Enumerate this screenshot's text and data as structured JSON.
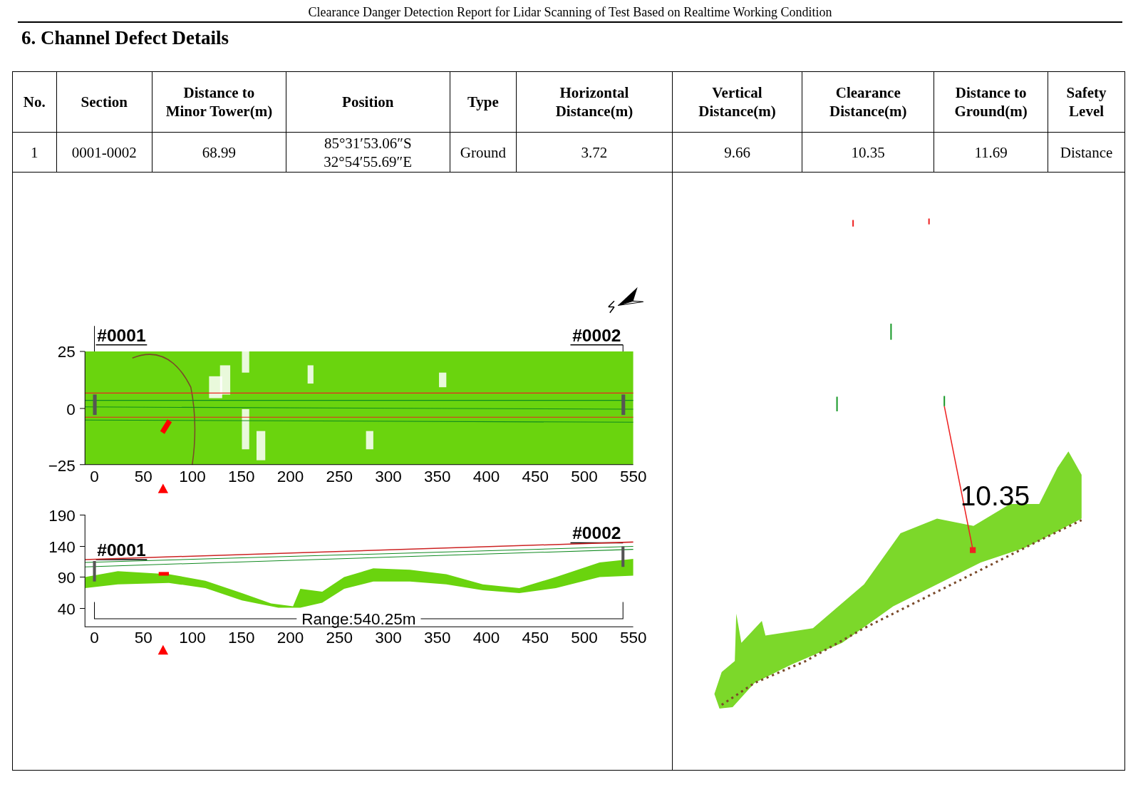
{
  "page_header": "Clearance Danger Detection Report for Lidar Scanning of Test Based on Realtime Working Condition",
  "section_title": "6. Channel Defect Details",
  "table": {
    "columns": [
      "No.",
      "Section",
      "Distance to Minor Tower(m)",
      "Position",
      "Type",
      "Horizontal Distance(m)",
      "Vertical Distance(m)",
      "Clearance Distance(m)",
      "Distance to Ground(m)",
      "Safety Level"
    ],
    "rows": [
      [
        "1",
        "0001-0002",
        "68.99",
        "85°31′53.06″S\n32°54′55.69″E",
        "Ground",
        "3.72",
        "9.66",
        "10.35",
        "11.69",
        "Distance"
      ]
    ]
  },
  "plan_view": {
    "start_tower": "#0001",
    "end_tower": "#0002",
    "yticks": [
      "25",
      "0",
      "−25"
    ],
    "xticks": [
      "0",
      "50",
      "100",
      "150",
      "200",
      "250",
      "300",
      "350",
      "400",
      "450",
      "500",
      "550"
    ]
  },
  "profile_view": {
    "start_tower": "#0001",
    "end_tower": "#0002",
    "yticks": [
      "190",
      "140",
      "90",
      "40"
    ],
    "xticks": [
      "0",
      "50",
      "100",
      "150",
      "200",
      "250",
      "300",
      "350",
      "400",
      "450",
      "500",
      "550"
    ],
    "range_label": "Range:540.25m"
  },
  "perspective_view": {
    "measurement_label": "10.35"
  }
}
